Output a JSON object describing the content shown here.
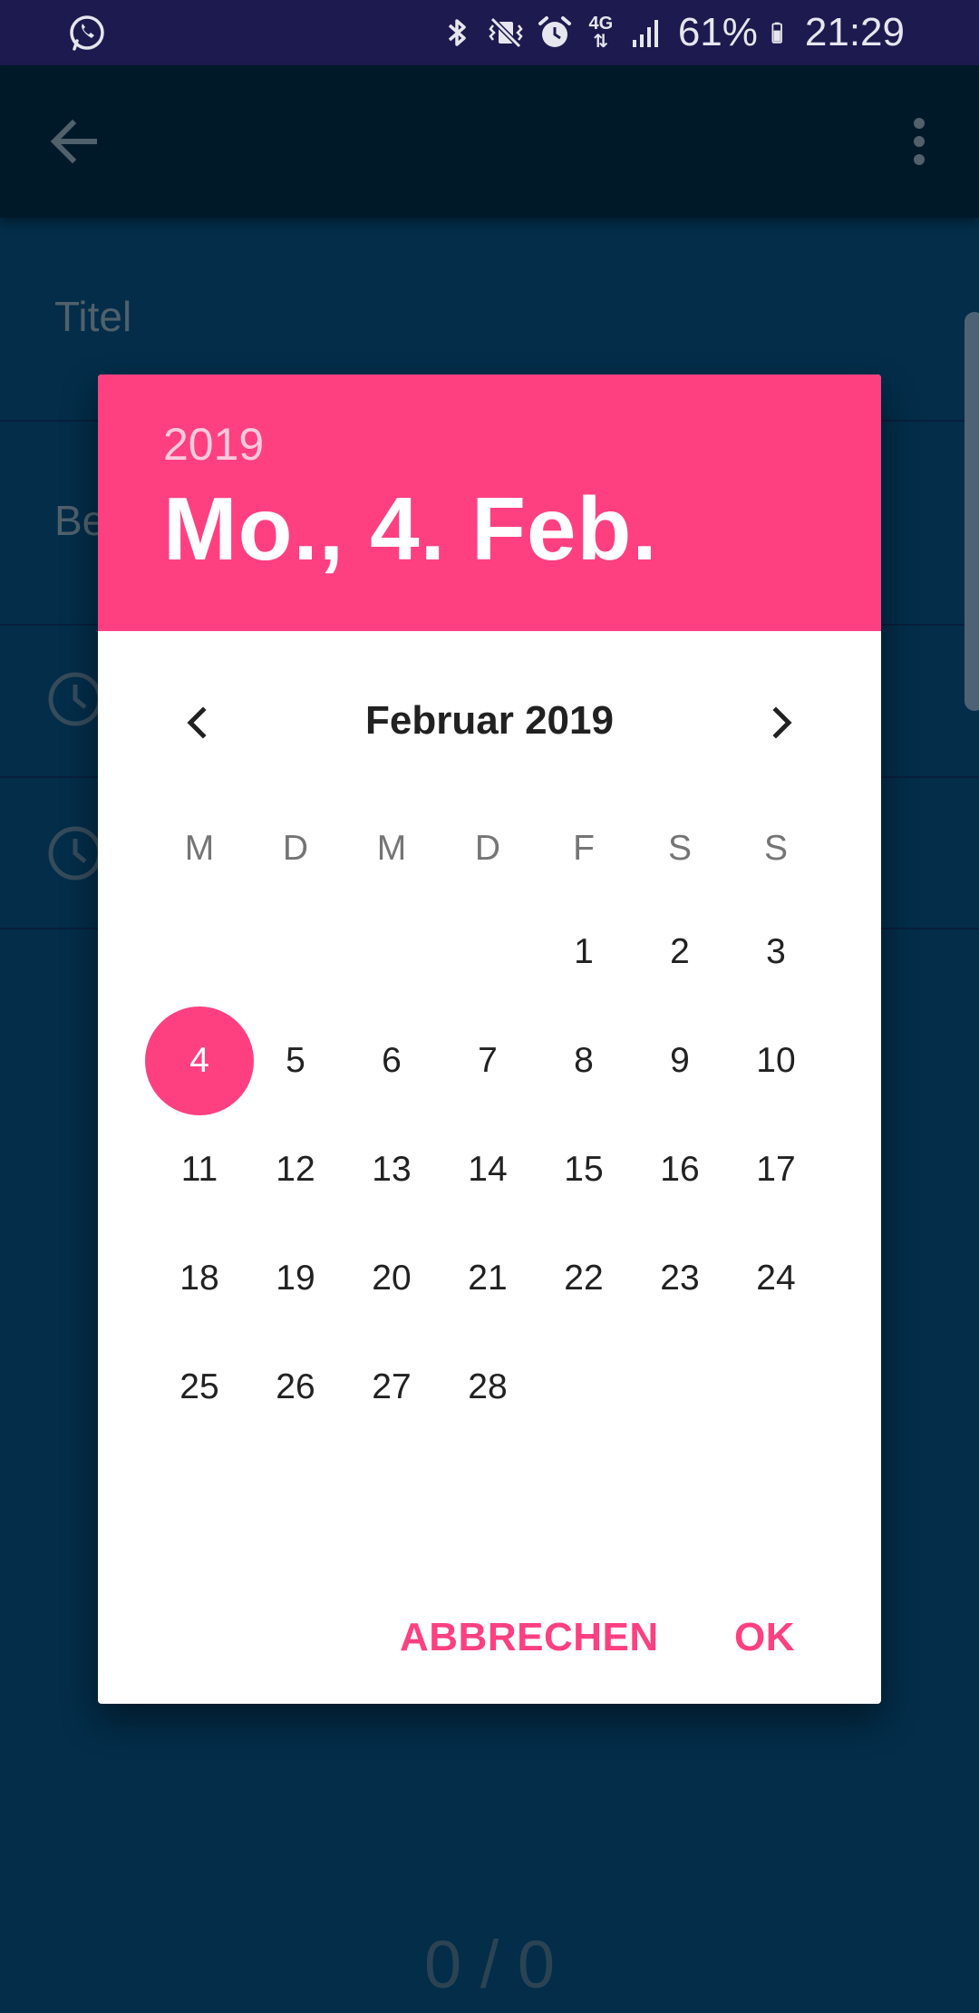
{
  "status_bar": {
    "battery": "61%",
    "time": "21:29",
    "network": "4G",
    "icons": [
      "whatsapp-icon",
      "bluetooth-icon",
      "vibrate-icon",
      "alarm-icon",
      "network-4g-icon",
      "signal-icon",
      "battery-icon"
    ]
  },
  "app_bar": {
    "icons": [
      "back-arrow-icon",
      "more-vert-icon"
    ]
  },
  "form": {
    "title_label": "Titel",
    "description_label_visible": "Be",
    "counter": "0 / 0"
  },
  "dialog": {
    "header": {
      "year": "2019",
      "date": "Mo., 4. Feb."
    },
    "month_label": "Februar 2019",
    "weekdays": [
      "M",
      "D",
      "M",
      "D",
      "F",
      "S",
      "S"
    ],
    "days": [
      "1",
      "2",
      "3",
      "4",
      "5",
      "6",
      "7",
      "8",
      "9",
      "10",
      "11",
      "12",
      "13",
      "14",
      "15",
      "16",
      "17",
      "18",
      "19",
      "20",
      "21",
      "22",
      "23",
      "24",
      "25",
      "26",
      "27",
      "28"
    ],
    "first_day_weekday_index": 4,
    "selected_day": "4",
    "cancel_label": "ABBRECHEN",
    "ok_label": "OK"
  },
  "colors": {
    "accent": "#fe4081",
    "background": "#053f66",
    "app_bar": "#01233a",
    "status_bar": "#1c1a4e"
  }
}
